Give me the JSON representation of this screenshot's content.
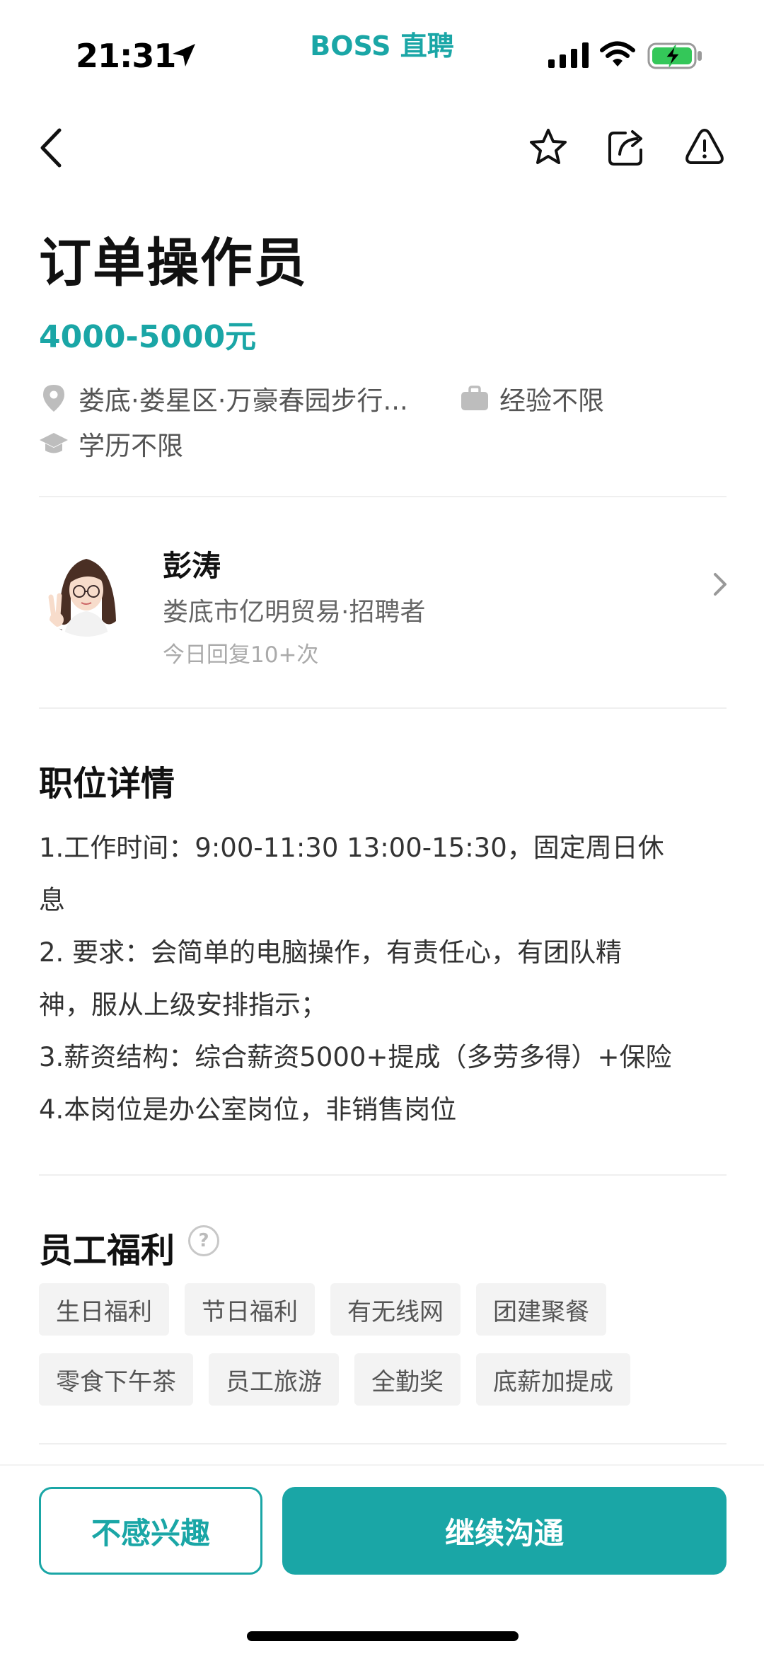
{
  "status_bar": {
    "time": "21:31",
    "brand": "BOSS 直聘",
    "icons": [
      "location-arrow-icon",
      "signal-icon",
      "wifi-icon",
      "battery-charging-icon"
    ]
  },
  "nav": {
    "icons": [
      "back-icon",
      "star-icon",
      "share-icon",
      "report-icon"
    ]
  },
  "job": {
    "title": "订单操作员",
    "salary": "4000-5000元",
    "location": "娄底·娄星区·万豪春园步行...",
    "experience": "经验不限",
    "education": "学历不限"
  },
  "recruiter": {
    "name": "彭涛",
    "company": "娄底市亿明贸易·招聘者",
    "reply": "今日回复10+次"
  },
  "details": {
    "title": "职位详情",
    "lines": [
      "1.工作时间：9:00-11:30   13:00-15:30，固定周日休",
      "息",
      "2. 要求：会简单的电脑操作，有责任心，有团队精",
      "神，服从上级安排指示；",
      "3.薪资结构：综合薪资5000+提成（多劳多得）+保险",
      "4.本岗位是办公室岗位，非销售岗位"
    ]
  },
  "benefits": {
    "title": "员工福利",
    "help": "?",
    "row1": [
      "生日福利",
      "节日福利",
      "有无线网",
      "团建聚餐"
    ],
    "row2": [
      "零食下午茶",
      "员工旅游",
      "全勤奖",
      "底薪加提成"
    ]
  },
  "actions": {
    "not_interested": "不感兴趣",
    "continue_chat": "继续沟通"
  },
  "colors": {
    "accent": "#1aa6a6",
    "battery": "#34c759"
  }
}
